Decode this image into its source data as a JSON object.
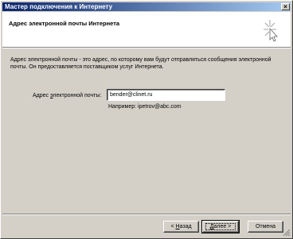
{
  "window": {
    "title": "Мастер подключения к Интернету",
    "close_glyph": "×"
  },
  "header": {
    "title": "Адрес электронной почты Интернета",
    "icon": "wizard-sparkle-icon"
  },
  "body": {
    "description": "Адрес электронной почты - это адрес, по которому вам будут отправляться сообщения электронной почты. Он предоставляется поставщиком услуг Интернета.",
    "email_label_pre": "Адрес ",
    "email_label_accel": "э",
    "email_label_post": "лектронной почты:",
    "email_value": "bender@clinet.ru",
    "example": "Например: ipetrov@abc.com"
  },
  "buttons": {
    "back_pre": "< ",
    "back_accel": "Н",
    "back_post": "азад",
    "next_pre": "",
    "next_accel": "Д",
    "next_post": "алее >",
    "cancel": "Отмена"
  },
  "colors": {
    "titlebar_start": "#0a246a",
    "titlebar_end": "#a6caf0",
    "face": "#d4d0c8"
  }
}
